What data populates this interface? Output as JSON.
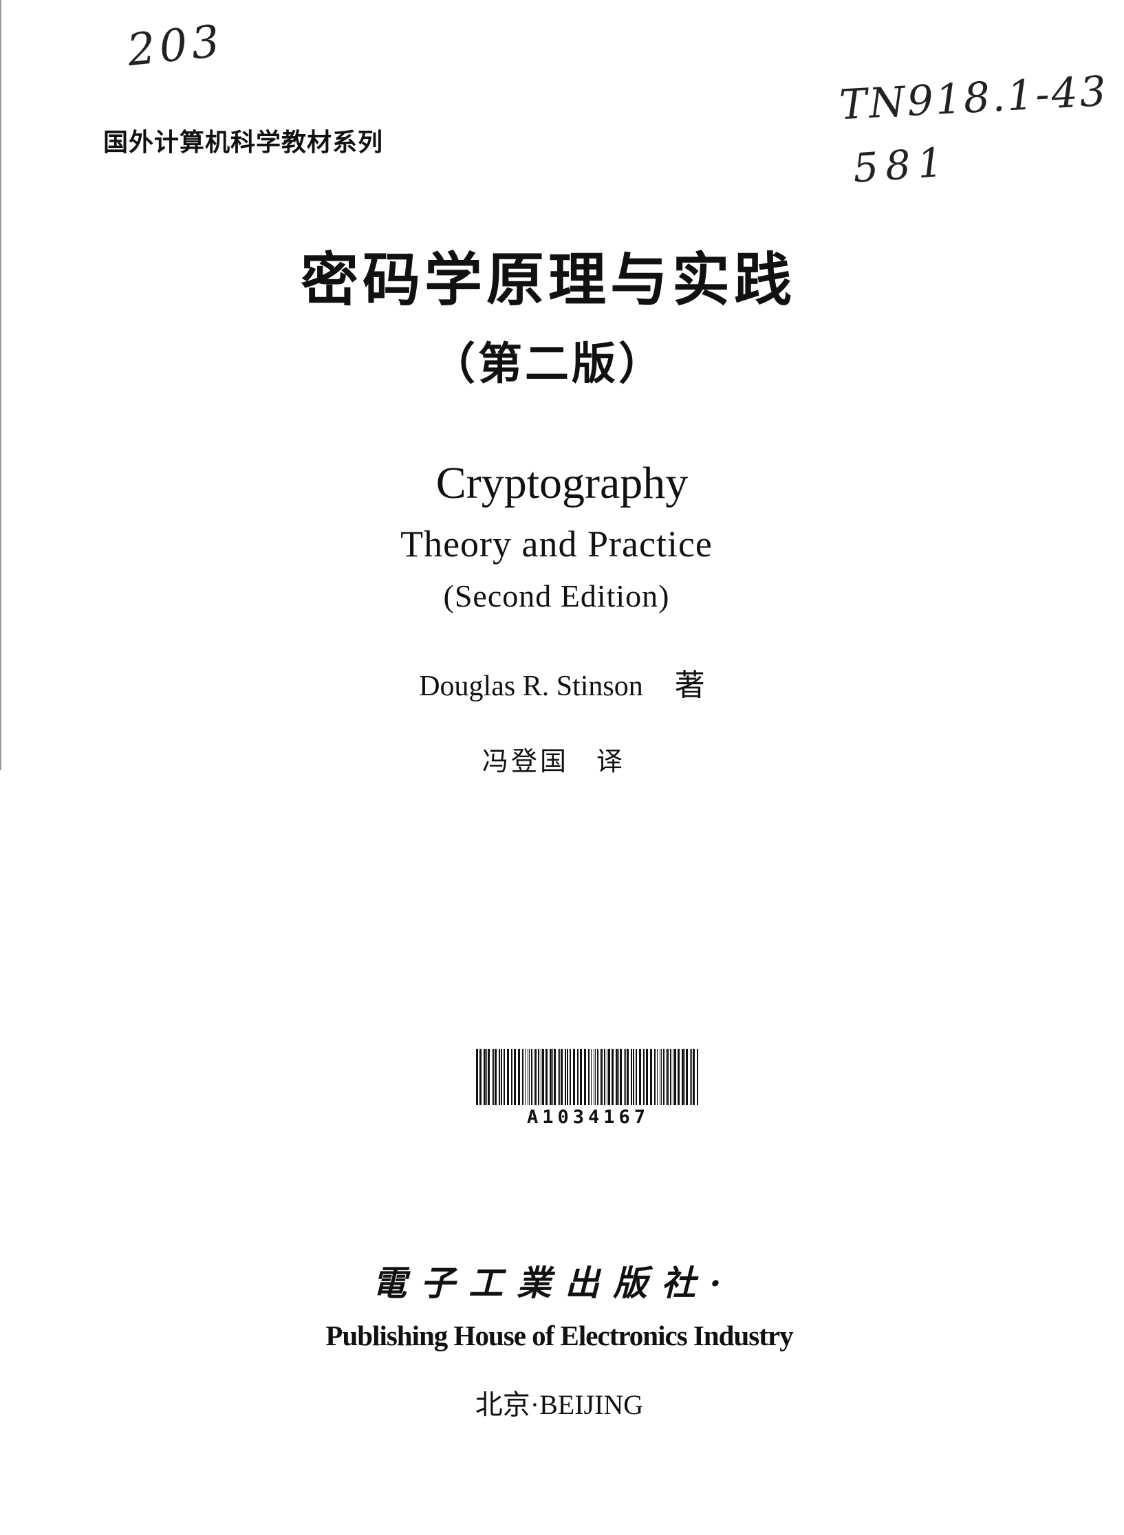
{
  "handwritten": {
    "top_left": "203",
    "call_number_line1": "TN918.1-43",
    "call_number_line2": "581"
  },
  "series_title": "国外计算机科学教材系列",
  "title_zh": "密码学原理与实践",
  "edition_zh": "（第二版）",
  "title_en": "Cryptography",
  "subtitle_en": "Theory and Practice",
  "edition_en": "(Second Edition)",
  "author": {
    "name": "Douglas R. Stinson",
    "role": "著"
  },
  "translator": {
    "name": "冯登国",
    "role": "译"
  },
  "barcode": {
    "number": "A1034167"
  },
  "publisher": {
    "name_zh": "電子工業出版社·",
    "name_en": "Publishing House of Electronics Industry",
    "city": "北京·BEIJING"
  }
}
